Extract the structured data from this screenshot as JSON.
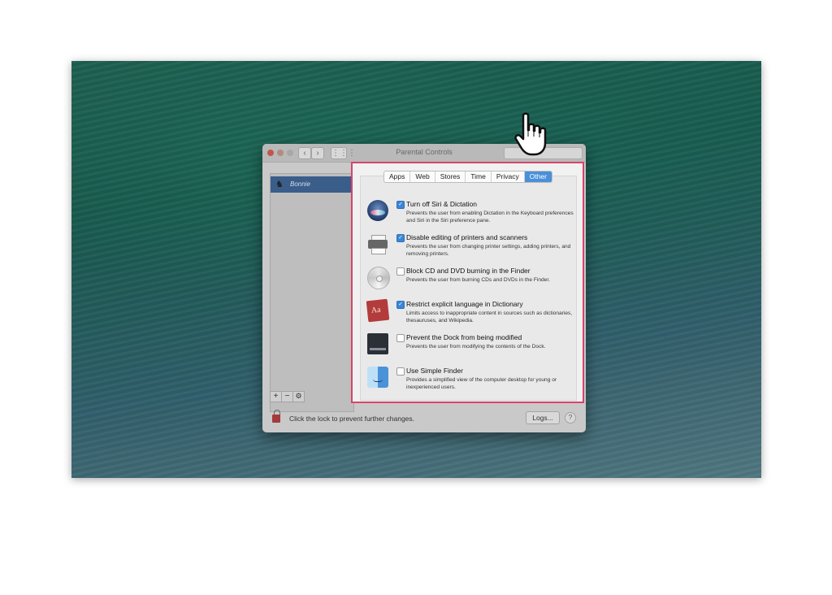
{
  "window": {
    "title": "Parental Controls",
    "sidebar": {
      "user_name": "Bonnie"
    },
    "footer": {
      "lock_text": "Click the lock to prevent further changes.",
      "logs_label": "Logs...",
      "help_label": "?"
    },
    "sidebar_buttons": {
      "add": "+",
      "remove": "−",
      "gear": "⚙"
    }
  },
  "tabs": [
    {
      "label": "Apps",
      "active": false
    },
    {
      "label": "Web",
      "active": false
    },
    {
      "label": "Stores",
      "active": false
    },
    {
      "label": "Time",
      "active": false
    },
    {
      "label": "Privacy",
      "active": false
    },
    {
      "label": "Other",
      "active": true
    }
  ],
  "options": [
    {
      "title": "Turn off Siri & Dictation",
      "desc": "Prevents the user from enabling Dictation in the Keyboard preferences and Siri in the Siri preference pane.",
      "checked": true,
      "icon": "siri-icon"
    },
    {
      "title": "Disable editing of printers and scanners",
      "desc": "Prevents the user from changing printer settings, adding printers, and removing printers.",
      "checked": true,
      "icon": "printer-icon"
    },
    {
      "title": "Block CD and DVD burning in the Finder",
      "desc": "Prevents the user from burning CDs and DVDs in the Finder.",
      "checked": false,
      "icon": "cd-icon"
    },
    {
      "title": "Restrict explicit language in Dictionary",
      "desc": "Limits access to inappropriate content in sources such as dictionaries, thesauruses, and Wikipedia.",
      "checked": true,
      "icon": "dictionary-icon"
    },
    {
      "title": "Prevent the Dock from being modified",
      "desc": "Prevents the user from modifying the contents of the Dock.",
      "checked": false,
      "icon": "dock-icon"
    },
    {
      "title": "Use Simple Finder",
      "desc": "Provides a simplified view of the computer desktop for young or inexperienced users.",
      "checked": false,
      "icon": "finder-icon"
    }
  ],
  "colors": {
    "highlight": "#d7446a",
    "accent": "#4a90d9",
    "selection": "#3a5d8a"
  }
}
